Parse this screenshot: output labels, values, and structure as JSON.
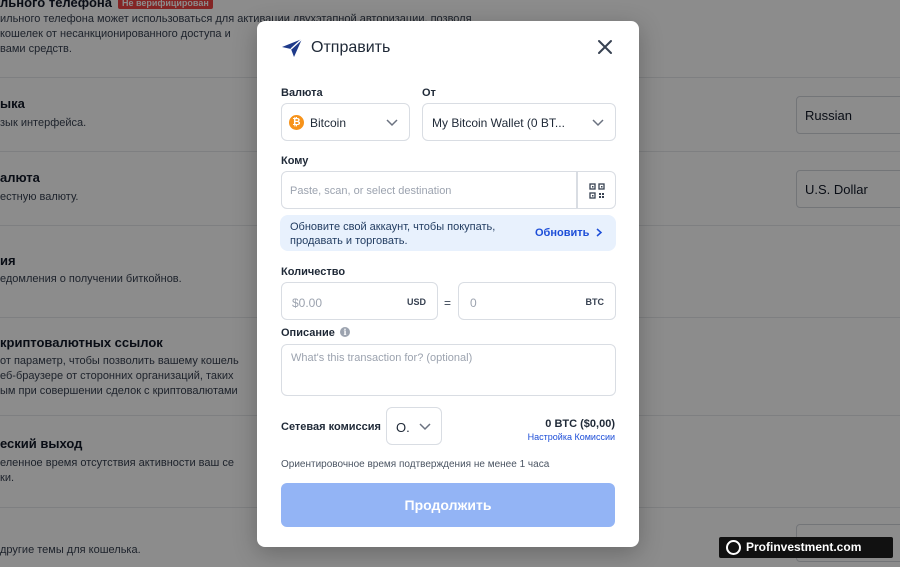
{
  "background": {
    "rows": [
      {
        "title": "льного телефона",
        "badge": "Не верифицирован",
        "desc": [
          "ильного телефона может использоваться для активации двухэтапной авторизации, позволя",
          "кошелек от несанкционированного доступа и",
          "вами средств."
        ]
      },
      {
        "title": "ыка",
        "desc": [
          "зык интерфейса."
        ],
        "select": "Russian"
      },
      {
        "title": "алюта",
        "desc": [
          "естную валюту."
        ],
        "select": "U.S. Dollar"
      },
      {
        "title": "ия",
        "desc": [
          "едомления о получении биткойнов."
        ]
      },
      {
        "title": "криптовалютных ссылок",
        "desc": [
          "от параметр, чтобы позволить вашему кошель",
          "еб-браузере от сторонних организаций, таких",
          "ым при совершении сделок с криптовалютами"
        ]
      },
      {
        "title": "еский выход",
        "desc": [
          "еленное время отсутствия активности ваш се",
          "ки."
        ]
      },
      {
        "title": "",
        "desc": [
          "другие темы для кошелька."
        ]
      }
    ]
  },
  "modal": {
    "title": "Отправить",
    "currency_label": "Валюта",
    "currency_value": "Bitcoin",
    "currency_icon": "bitcoin-icon",
    "from_label": "От",
    "from_value": "My Bitcoin Wallet (0 BT...",
    "to_label": "Кому",
    "to_placeholder": "Paste, scan, or select destination",
    "upgrade_banner": {
      "text": "Обновите свой аккаунт, чтобы покупать, продавать и торговать.",
      "link": "Обновить"
    },
    "amount_label": "Количество",
    "amount_fiat_placeholder": "$0.00",
    "amount_fiat_unit": "USD",
    "equals": "=",
    "amount_crypto_placeholder": "0",
    "amount_crypto_unit": "BTC",
    "description_label": "Описание",
    "description_placeholder": "What's this transaction for? (optional)",
    "fee_label": "Сетевая комиссия",
    "fee_value": "O.",
    "fee_amount": "0 BTC ($0,00)",
    "fee_settings_link": "Настройка Комиссии",
    "confirm_note": "Ориентировочное время подтверждения не менее 1 часа",
    "continue_label": "Продолжить"
  },
  "watermark": "Profinvestment.com",
  "colors": {
    "accent": "#1d4ed8",
    "button_disabled": "#93b4f5",
    "banner_bg": "#e8f1fd",
    "bitcoin": "#f7931a",
    "badge_red": "#ef4444"
  }
}
